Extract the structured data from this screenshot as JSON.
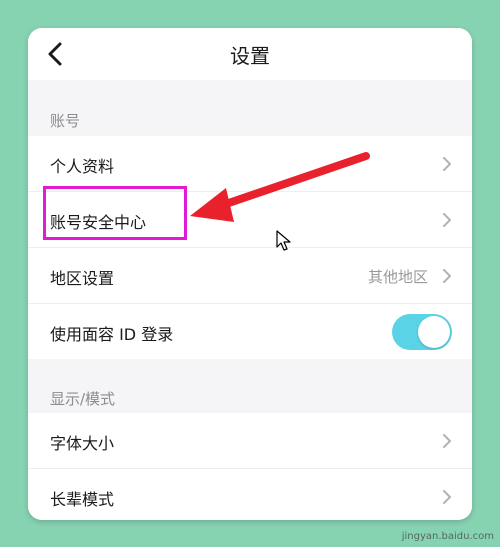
{
  "nav": {
    "title": "设置",
    "back_icon": "chevron-left-icon"
  },
  "sections": {
    "account": {
      "label": "账号",
      "items": [
        {
          "label": "个人资料"
        },
        {
          "label": "账号安全中心"
        },
        {
          "label": "地区设置",
          "value": "其他地区"
        },
        {
          "label": "使用面容 ID 登录",
          "toggle": "on"
        }
      ]
    },
    "display": {
      "label": "显示/模式",
      "items": [
        {
          "label": "字体大小"
        },
        {
          "label": "长辈模式"
        }
      ]
    }
  },
  "annotation": {
    "highlight_color": "#e21ad8",
    "arrow_color": "#e8212c"
  },
  "watermark": {
    "text": "jingyan.baidu.com"
  },
  "colors": {
    "accent_toggle": "#5bd3e6",
    "background": "#86d3b2"
  }
}
